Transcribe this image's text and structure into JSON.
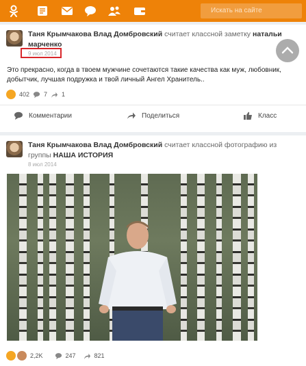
{
  "topbar": {
    "color": "#ee8208",
    "icons": [
      "odnoklassniki-logo-icon",
      "feed-icon",
      "messages-icon",
      "discussions-icon",
      "friends-icon",
      "wallet-icon"
    ],
    "search_placeholder": "Искать на сайте"
  },
  "post1": {
    "author": "Таня Крымчакова Влад Домбровский",
    "action": "считает классной заметку",
    "target": "натальи марченко",
    "date": "9 июл 2014",
    "text": "Это прекрасно, когда в твоем мужчине сочетаются такие качества как муж, любовник, добытчик, лучшая подружка и твой личный Ангел Хранитель..",
    "likes": "402",
    "comments": "7",
    "shares": "1",
    "actions": {
      "comments": "Комментарии",
      "share": "Поделиться",
      "like": "Класс"
    }
  },
  "post2": {
    "author": "Таня Крымчакова Влад Домбровский",
    "action": "считает классной фотографию из группы",
    "target": "НАША ИСТОРИЯ",
    "date": "8 июл 2014",
    "likes": "2,2K",
    "comments": "247",
    "shares": "821"
  }
}
